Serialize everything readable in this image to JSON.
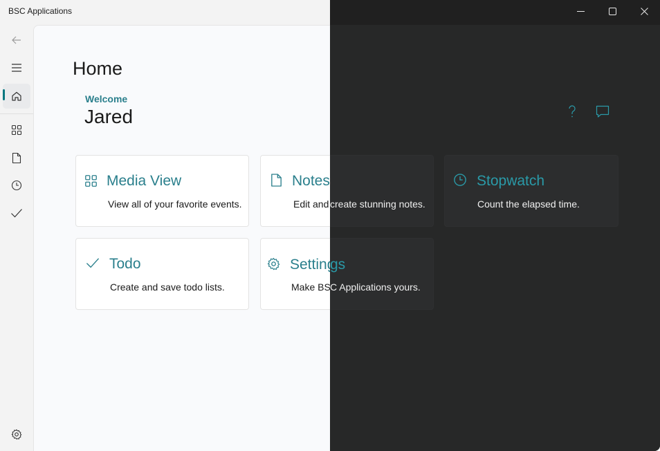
{
  "app": {
    "title": "BSC Applications"
  },
  "window_controls": [
    "minimize-icon",
    "maximize-icon",
    "close-icon"
  ],
  "nav": {
    "items": [
      {
        "icon": "back-arrow-icon"
      },
      {
        "icon": "hamburger-menu-icon"
      },
      {
        "icon": "home-icon",
        "selected": true
      },
      {
        "icon": "grid-icon"
      },
      {
        "icon": "document-icon"
      },
      {
        "icon": "clock-icon"
      },
      {
        "icon": "checkmark-icon"
      }
    ],
    "footer_icon": "gear-icon"
  },
  "page": {
    "title": "Home",
    "welcome_label": "Welcome",
    "username": "Jared"
  },
  "header_actions": [
    "help-icon",
    "feedback-icon"
  ],
  "cards": {
    "media": {
      "title": "Media View",
      "description": "View all of your favorite events.",
      "icon": "grid-icon"
    },
    "notes": {
      "title": "Notes",
      "description": "Edit and create stunning notes.",
      "icon": "document-icon"
    },
    "stopwatch": {
      "title": "Stopwatch",
      "description": "Count the elapsed time.",
      "icon": "clock-icon"
    },
    "todo": {
      "title": "Todo",
      "description": "Create and save todo lists.",
      "icon": "checkmark-icon"
    },
    "settings": {
      "title": "Settings",
      "description": "Make BSC Applications yours.",
      "icon": "gear-icon"
    }
  },
  "colors": {
    "accent": "#2a7f8c",
    "light_bg": "#f3f3f3",
    "dark_bg": "#202020"
  }
}
